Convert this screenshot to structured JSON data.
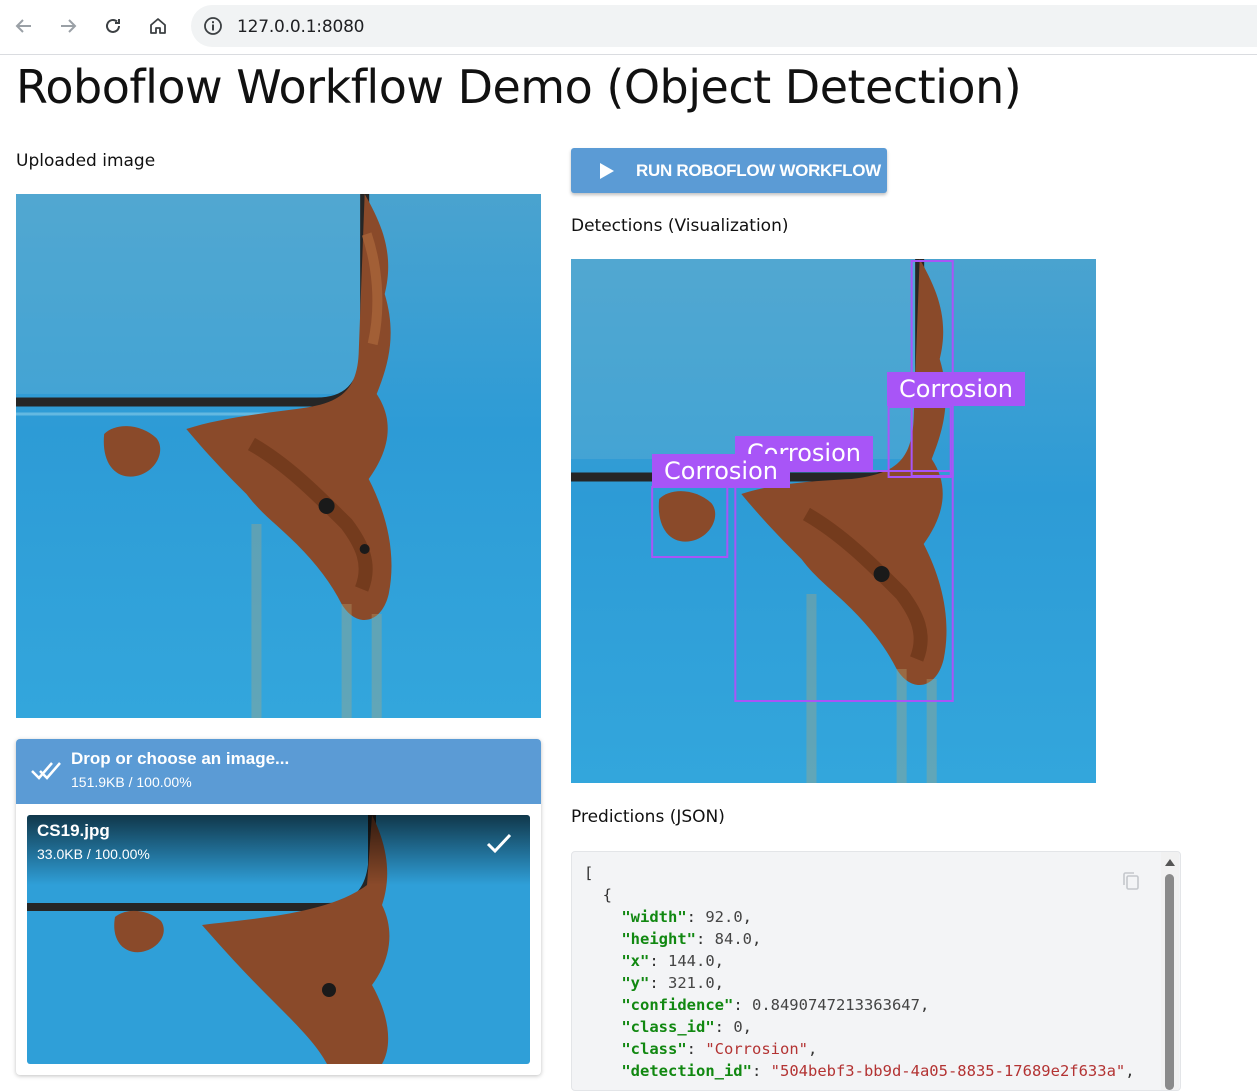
{
  "browser": {
    "url": "127.0.0.1:8080",
    "icons": [
      "back-arrow-icon",
      "forward-arrow-icon",
      "reload-icon",
      "home-icon",
      "site-info-icon"
    ]
  },
  "page": {
    "title": "Roboflow Workflow Demo (Object Detection)"
  },
  "left": {
    "uploaded_label": "Uploaded image",
    "uploader": {
      "title": "Drop or choose an image...",
      "progress": "151.9KB / 100.00%",
      "file": {
        "name": "CS19.jpg",
        "progress": "33.0KB / 100.00%"
      }
    }
  },
  "right": {
    "run_button": "RUN ROBOFLOW WORKFLOW",
    "detections_label": "Detections (Visualization)",
    "predictions_label": "Predictions (JSON)",
    "detection_labels": [
      "Corrosion",
      "Corrosion",
      "Corrosion"
    ]
  },
  "json_view": {
    "open_bracket": "[",
    "open_brace": "{",
    "prediction": {
      "width": "92.0",
      "height": "84.0",
      "x": "144.0",
      "y": "321.0",
      "confidence": "0.8490747213363647",
      "class_id": "0",
      "class": "\"Corrosion\"",
      "detection_id": "\"504bebf3-bb9d-4a05-8835-17689e2f633a\""
    }
  },
  "colors": {
    "accent_blue": "#5b9bd5",
    "detection_purple": "#a855f7",
    "json_key": "#118811",
    "json_string": "#b33333"
  }
}
